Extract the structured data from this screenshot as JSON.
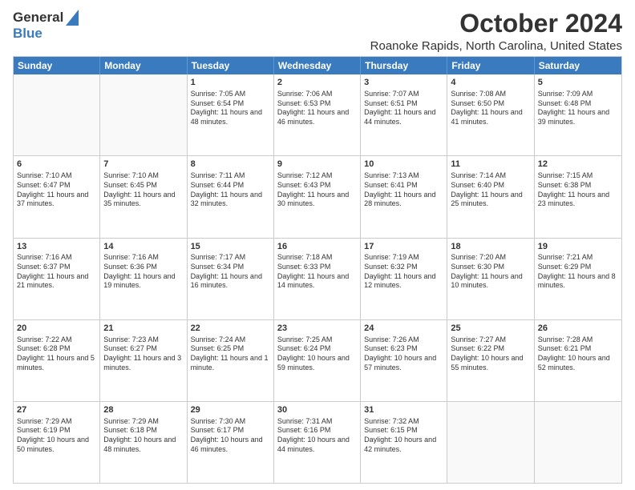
{
  "logo": {
    "general": "General",
    "blue": "Blue"
  },
  "header": {
    "month_year": "October 2024",
    "location": "Roanoke Rapids, North Carolina, United States"
  },
  "days_of_week": [
    "Sunday",
    "Monday",
    "Tuesday",
    "Wednesday",
    "Thursday",
    "Friday",
    "Saturday"
  ],
  "weeks": [
    [
      {
        "day": "",
        "sunrise": "",
        "sunset": "",
        "daylight": ""
      },
      {
        "day": "",
        "sunrise": "",
        "sunset": "",
        "daylight": ""
      },
      {
        "day": "1",
        "sunrise": "Sunrise: 7:05 AM",
        "sunset": "Sunset: 6:54 PM",
        "daylight": "Daylight: 11 hours and 48 minutes."
      },
      {
        "day": "2",
        "sunrise": "Sunrise: 7:06 AM",
        "sunset": "Sunset: 6:53 PM",
        "daylight": "Daylight: 11 hours and 46 minutes."
      },
      {
        "day": "3",
        "sunrise": "Sunrise: 7:07 AM",
        "sunset": "Sunset: 6:51 PM",
        "daylight": "Daylight: 11 hours and 44 minutes."
      },
      {
        "day": "4",
        "sunrise": "Sunrise: 7:08 AM",
        "sunset": "Sunset: 6:50 PM",
        "daylight": "Daylight: 11 hours and 41 minutes."
      },
      {
        "day": "5",
        "sunrise": "Sunrise: 7:09 AM",
        "sunset": "Sunset: 6:48 PM",
        "daylight": "Daylight: 11 hours and 39 minutes."
      }
    ],
    [
      {
        "day": "6",
        "sunrise": "Sunrise: 7:10 AM",
        "sunset": "Sunset: 6:47 PM",
        "daylight": "Daylight: 11 hours and 37 minutes."
      },
      {
        "day": "7",
        "sunrise": "Sunrise: 7:10 AM",
        "sunset": "Sunset: 6:45 PM",
        "daylight": "Daylight: 11 hours and 35 minutes."
      },
      {
        "day": "8",
        "sunrise": "Sunrise: 7:11 AM",
        "sunset": "Sunset: 6:44 PM",
        "daylight": "Daylight: 11 hours and 32 minutes."
      },
      {
        "day": "9",
        "sunrise": "Sunrise: 7:12 AM",
        "sunset": "Sunset: 6:43 PM",
        "daylight": "Daylight: 11 hours and 30 minutes."
      },
      {
        "day": "10",
        "sunrise": "Sunrise: 7:13 AM",
        "sunset": "Sunset: 6:41 PM",
        "daylight": "Daylight: 11 hours and 28 minutes."
      },
      {
        "day": "11",
        "sunrise": "Sunrise: 7:14 AM",
        "sunset": "Sunset: 6:40 PM",
        "daylight": "Daylight: 11 hours and 25 minutes."
      },
      {
        "day": "12",
        "sunrise": "Sunrise: 7:15 AM",
        "sunset": "Sunset: 6:38 PM",
        "daylight": "Daylight: 11 hours and 23 minutes."
      }
    ],
    [
      {
        "day": "13",
        "sunrise": "Sunrise: 7:16 AM",
        "sunset": "Sunset: 6:37 PM",
        "daylight": "Daylight: 11 hours and 21 minutes."
      },
      {
        "day": "14",
        "sunrise": "Sunrise: 7:16 AM",
        "sunset": "Sunset: 6:36 PM",
        "daylight": "Daylight: 11 hours and 19 minutes."
      },
      {
        "day": "15",
        "sunrise": "Sunrise: 7:17 AM",
        "sunset": "Sunset: 6:34 PM",
        "daylight": "Daylight: 11 hours and 16 minutes."
      },
      {
        "day": "16",
        "sunrise": "Sunrise: 7:18 AM",
        "sunset": "Sunset: 6:33 PM",
        "daylight": "Daylight: 11 hours and 14 minutes."
      },
      {
        "day": "17",
        "sunrise": "Sunrise: 7:19 AM",
        "sunset": "Sunset: 6:32 PM",
        "daylight": "Daylight: 11 hours and 12 minutes."
      },
      {
        "day": "18",
        "sunrise": "Sunrise: 7:20 AM",
        "sunset": "Sunset: 6:30 PM",
        "daylight": "Daylight: 11 hours and 10 minutes."
      },
      {
        "day": "19",
        "sunrise": "Sunrise: 7:21 AM",
        "sunset": "Sunset: 6:29 PM",
        "daylight": "Daylight: 11 hours and 8 minutes."
      }
    ],
    [
      {
        "day": "20",
        "sunrise": "Sunrise: 7:22 AM",
        "sunset": "Sunset: 6:28 PM",
        "daylight": "Daylight: 11 hours and 5 minutes."
      },
      {
        "day": "21",
        "sunrise": "Sunrise: 7:23 AM",
        "sunset": "Sunset: 6:27 PM",
        "daylight": "Daylight: 11 hours and 3 minutes."
      },
      {
        "day": "22",
        "sunrise": "Sunrise: 7:24 AM",
        "sunset": "Sunset: 6:25 PM",
        "daylight": "Daylight: 11 hours and 1 minute."
      },
      {
        "day": "23",
        "sunrise": "Sunrise: 7:25 AM",
        "sunset": "Sunset: 6:24 PM",
        "daylight": "Daylight: 10 hours and 59 minutes."
      },
      {
        "day": "24",
        "sunrise": "Sunrise: 7:26 AM",
        "sunset": "Sunset: 6:23 PM",
        "daylight": "Daylight: 10 hours and 57 minutes."
      },
      {
        "day": "25",
        "sunrise": "Sunrise: 7:27 AM",
        "sunset": "Sunset: 6:22 PM",
        "daylight": "Daylight: 10 hours and 55 minutes."
      },
      {
        "day": "26",
        "sunrise": "Sunrise: 7:28 AM",
        "sunset": "Sunset: 6:21 PM",
        "daylight": "Daylight: 10 hours and 52 minutes."
      }
    ],
    [
      {
        "day": "27",
        "sunrise": "Sunrise: 7:29 AM",
        "sunset": "Sunset: 6:19 PM",
        "daylight": "Daylight: 10 hours and 50 minutes."
      },
      {
        "day": "28",
        "sunrise": "Sunrise: 7:29 AM",
        "sunset": "Sunset: 6:18 PM",
        "daylight": "Daylight: 10 hours and 48 minutes."
      },
      {
        "day": "29",
        "sunrise": "Sunrise: 7:30 AM",
        "sunset": "Sunset: 6:17 PM",
        "daylight": "Daylight: 10 hours and 46 minutes."
      },
      {
        "day": "30",
        "sunrise": "Sunrise: 7:31 AM",
        "sunset": "Sunset: 6:16 PM",
        "daylight": "Daylight: 10 hours and 44 minutes."
      },
      {
        "day": "31",
        "sunrise": "Sunrise: 7:32 AM",
        "sunset": "Sunset: 6:15 PM",
        "daylight": "Daylight: 10 hours and 42 minutes."
      },
      {
        "day": "",
        "sunrise": "",
        "sunset": "",
        "daylight": ""
      },
      {
        "day": "",
        "sunrise": "",
        "sunset": "",
        "daylight": ""
      }
    ]
  ]
}
